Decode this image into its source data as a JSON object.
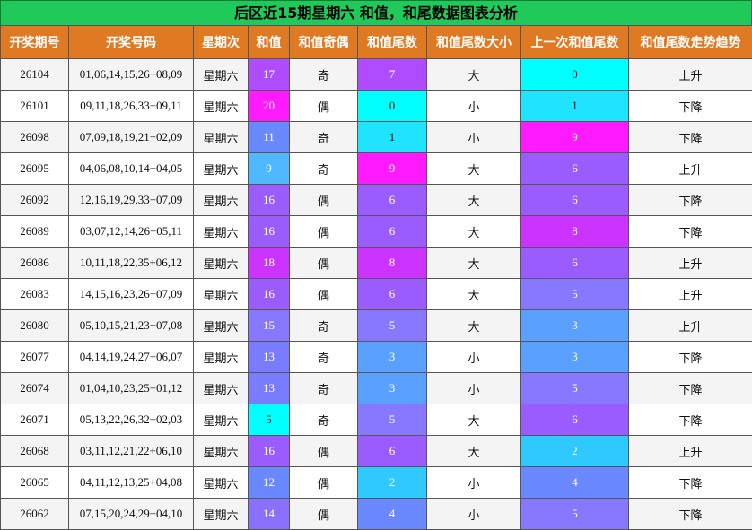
{
  "title": "后区近15期星期六 和值，和尾数据图表分析",
  "headers": [
    "开奖期号",
    "开奖号码",
    "星期次",
    "和值",
    "和值奇偶",
    "和值尾数",
    "和值尾数大小",
    "上一次和值尾数",
    "和值尾数走势趋势"
  ],
  "colors": {
    "header_bg": "#e07a22",
    "title_bg": "#1fc95a",
    "magenta": "#ff1aff",
    "purple": "#b04cff",
    "violet": "#9a5cff",
    "blue": "#6a88ff",
    "lightblue": "#4fb8ff",
    "cyan": "#1fe3ff",
    "aqua": "#00ffff"
  },
  "rows": [
    {
      "period": "26104",
      "numbers": "01,06,14,15,26+08,09",
      "weekday": "星期六",
      "sum": "17",
      "parity": "奇",
      "tail": "7",
      "size": "大",
      "prev_tail": "0",
      "trend": "上升",
      "sum_color": "#b04cff",
      "tail_color": "#b04cff",
      "prev_color": "#00ffff"
    },
    {
      "period": "26101",
      "numbers": "09,11,18,26,33+09,11",
      "weekday": "星期六",
      "sum": "20",
      "parity": "偶",
      "tail": "0",
      "size": "小",
      "prev_tail": "1",
      "trend": "下降",
      "sum_color": "#ff1aff",
      "tail_color": "#00ffff",
      "prev_color": "#1fe3ff"
    },
    {
      "period": "26098",
      "numbers": "07,09,18,19,21+02,09",
      "weekday": "星期六",
      "sum": "11",
      "parity": "奇",
      "tail": "1",
      "size": "小",
      "prev_tail": "9",
      "trend": "下降",
      "sum_color": "#6a88ff",
      "tail_color": "#1fe3ff",
      "prev_color": "#ff1aff"
    },
    {
      "period": "26095",
      "numbers": "04,06,08,10,14+04,05",
      "weekday": "星期六",
      "sum": "9",
      "parity": "奇",
      "tail": "9",
      "size": "大",
      "prev_tail": "6",
      "trend": "上升",
      "sum_color": "#4fb8ff",
      "tail_color": "#ff1aff",
      "prev_color": "#9a5cff"
    },
    {
      "period": "26092",
      "numbers": "12,16,19,29,33+07,09",
      "weekday": "星期六",
      "sum": "16",
      "parity": "偶",
      "tail": "6",
      "size": "大",
      "prev_tail": "6",
      "trend": "下降",
      "sum_color": "#9a5cff",
      "tail_color": "#9a5cff",
      "prev_color": "#9a5cff"
    },
    {
      "period": "26089",
      "numbers": "03,07,12,14,26+05,11",
      "weekday": "星期六",
      "sum": "16",
      "parity": "偶",
      "tail": "6",
      "size": "大",
      "prev_tail": "8",
      "trend": "下降",
      "sum_color": "#9a5cff",
      "tail_color": "#9a5cff",
      "prev_color": "#cc33ff"
    },
    {
      "period": "26086",
      "numbers": "10,11,18,22,35+06,12",
      "weekday": "星期六",
      "sum": "18",
      "parity": "偶",
      "tail": "8",
      "size": "大",
      "prev_tail": "6",
      "trend": "上升",
      "sum_color": "#cc33ff",
      "tail_color": "#cc33ff",
      "prev_color": "#9a5cff"
    },
    {
      "period": "26083",
      "numbers": "14,15,16,23,26+07,09",
      "weekday": "星期六",
      "sum": "16",
      "parity": "偶",
      "tail": "6",
      "size": "大",
      "prev_tail": "5",
      "trend": "上升",
      "sum_color": "#9a5cff",
      "tail_color": "#9a5cff",
      "prev_color": "#8877ff"
    },
    {
      "period": "26080",
      "numbers": "05,10,15,21,23+07,08",
      "weekday": "星期六",
      "sum": "15",
      "parity": "奇",
      "tail": "5",
      "size": "大",
      "prev_tail": "3",
      "trend": "上升",
      "sum_color": "#8877ff",
      "tail_color": "#8877ff",
      "prev_color": "#5aa0ff"
    },
    {
      "period": "26077",
      "numbers": "04,14,19,24,27+06,07",
      "weekday": "星期六",
      "sum": "13",
      "parity": "奇",
      "tail": "3",
      "size": "小",
      "prev_tail": "3",
      "trend": "下降",
      "sum_color": "#7a7cff",
      "tail_color": "#5aa0ff",
      "prev_color": "#5aa0ff"
    },
    {
      "period": "26074",
      "numbers": "01,04,10,23,25+01,12",
      "weekday": "星期六",
      "sum": "13",
      "parity": "奇",
      "tail": "3",
      "size": "小",
      "prev_tail": "5",
      "trend": "下降",
      "sum_color": "#7a7cff",
      "tail_color": "#5aa0ff",
      "prev_color": "#8877ff"
    },
    {
      "period": "26071",
      "numbers": "05,13,22,26,32+02,03",
      "weekday": "星期六",
      "sum": "5",
      "parity": "奇",
      "tail": "5",
      "size": "大",
      "prev_tail": "6",
      "trend": "下降",
      "sum_color": "#00ffff",
      "tail_color": "#8877ff",
      "prev_color": "#9a5cff"
    },
    {
      "period": "26068",
      "numbers": "03,11,12,21,22+06,10",
      "weekday": "星期六",
      "sum": "16",
      "parity": "偶",
      "tail": "6",
      "size": "大",
      "prev_tail": "2",
      "trend": "上升",
      "sum_color": "#9a5cff",
      "tail_color": "#9a5cff",
      "prev_color": "#2fc8ff"
    },
    {
      "period": "26065",
      "numbers": "04,11,12,13,25+04,08",
      "weekday": "星期六",
      "sum": "12",
      "parity": "偶",
      "tail": "2",
      "size": "小",
      "prev_tail": "4",
      "trend": "下降",
      "sum_color": "#6a88ff",
      "tail_color": "#2fc8ff",
      "prev_color": "#6a88ff"
    },
    {
      "period": "26062",
      "numbers": "07,15,20,24,29+04,10",
      "weekday": "星期六",
      "sum": "14",
      "parity": "偶",
      "tail": "4",
      "size": "小",
      "prev_tail": "5",
      "trend": "下降",
      "sum_color": "#8a70ff",
      "tail_color": "#6a88ff",
      "prev_color": "#8877ff"
    }
  ]
}
